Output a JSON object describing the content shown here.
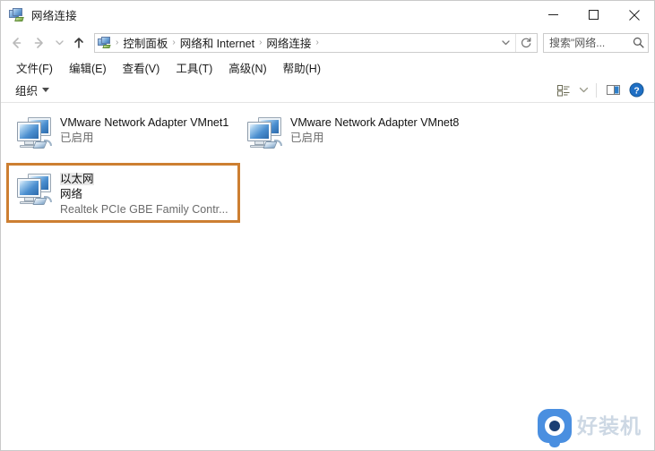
{
  "window": {
    "title": "网络连接",
    "title_icon": "network-connections-icon",
    "controls": {
      "minimize": "minimize-icon",
      "maximize": "maximize-icon",
      "close": "close-icon"
    }
  },
  "navigation": {
    "back": "back-arrow-icon",
    "forward": "forward-arrow-icon",
    "recent": "recent-locations-icon",
    "up": "up-arrow-icon"
  },
  "address_bar": {
    "icon": "network-connections-icon",
    "breadcrumbs": [
      {
        "label": "控制面板"
      },
      {
        "label": "网络和 Internet"
      },
      {
        "label": "网络连接"
      }
    ],
    "separator": "›",
    "history_dropdown": "chevron-down-icon",
    "refresh": "refresh-icon"
  },
  "search": {
    "placeholder": "搜索\"网络...",
    "icon": "search-icon"
  },
  "menubar": {
    "items": [
      {
        "label": "文件(F)"
      },
      {
        "label": "编辑(E)"
      },
      {
        "label": "查看(V)"
      },
      {
        "label": "工具(T)"
      },
      {
        "label": "高级(N)"
      },
      {
        "label": "帮助(H)"
      }
    ]
  },
  "toolbar": {
    "organize_label": "组织",
    "organize_caret": "chevron-down-icon",
    "view_options_icon": "view-options-icon",
    "view_dropdown_icon": "chevron-down-icon",
    "preview_pane_icon": "preview-pane-icon",
    "help_icon": "help-circle-icon"
  },
  "connections": [
    {
      "name": "VMware Network Adapter VMnet1",
      "subtitle": "",
      "status": "已启用",
      "icon": "network-adapter-icon",
      "selected": false
    },
    {
      "name": "VMware Network Adapter VMnet8",
      "subtitle": "",
      "status": "已启用",
      "icon": "network-adapter-icon",
      "selected": false
    },
    {
      "name": "以太网",
      "subtitle": "网络",
      "status": "Realtek PCIe GBE Family Contr...",
      "icon": "network-adapter-icon",
      "selected": true
    }
  ],
  "watermark": {
    "text": "好装机",
    "icon": "eye-logo-icon"
  },
  "colors": {
    "selection_border": "#cd7f32",
    "accent": "#1f6fc4",
    "status_text": "#6b6b6b",
    "watermark_blue": "#4a8fe0",
    "watermark_text": "#cdd8e4"
  }
}
